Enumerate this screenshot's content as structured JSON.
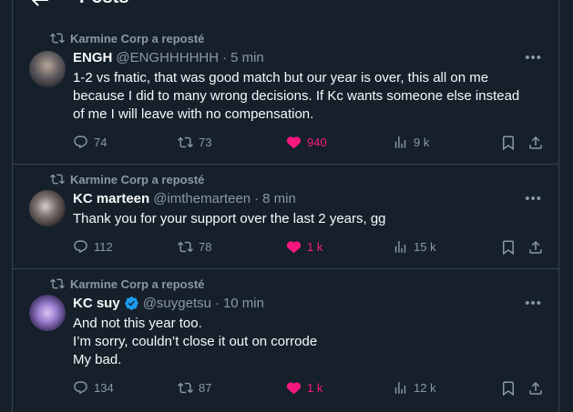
{
  "header": {
    "title": "Posts"
  },
  "colors": {
    "background": "#15202b",
    "muted": "#8b98a5",
    "like": "#f91880",
    "verified": "#1d9bf0"
  },
  "tweets": [
    {
      "repost_label": "Karmine Corp a reposté",
      "name": "ENGH",
      "handle": "@ENGHHHHHH",
      "separator": "·",
      "time": "5 min",
      "verified": false,
      "lines": [
        "1-2 vs fnatic, that was good match but our year is over, this all on me",
        "because I did to many wrong decisions. If Kc wants someone else instead",
        "of me I will leave with no compensation."
      ],
      "replies": "74",
      "reposts": "73",
      "likes": "940",
      "views": "9 k"
    },
    {
      "repost_label": "Karmine Corp a reposté",
      "name": "KC marteen",
      "handle": "@imthemarteen",
      "separator": "·",
      "time": "8 min",
      "verified": false,
      "lines": [
        "Thank you for your support over the last 2 years, gg"
      ],
      "replies": "112",
      "reposts": "78",
      "likes": "1 k",
      "views": "15 k"
    },
    {
      "repost_label": "Karmine Corp a reposté",
      "name": "KC suy",
      "handle": "@suygetsu",
      "separator": "·",
      "time": "10 min",
      "verified": true,
      "lines": [
        "And not this year too.",
        "I’m sorry, couldn’t close it out on corrode",
        "My bad."
      ],
      "replies": "134",
      "reposts": "87",
      "likes": "1 k",
      "views": "12 k"
    }
  ]
}
